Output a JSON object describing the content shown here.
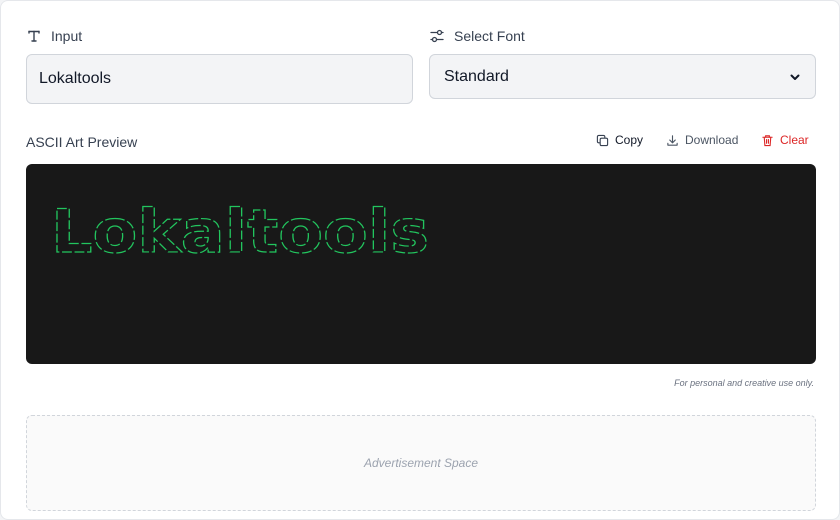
{
  "input": {
    "label": "Input",
    "value": "Lokaltools"
  },
  "font": {
    "label": "Select Font",
    "selected": "Standard"
  },
  "preview": {
    "title": "ASCII Art Preview",
    "text": "Lokaltools",
    "text_color": "#22c55e",
    "background": "#181818"
  },
  "actions": {
    "copy": "Copy",
    "download": "Download",
    "clear": "Clear",
    "clear_color": "#dc2626"
  },
  "disclaimer": "For personal and creative use only.",
  "ad_text": "Advertisement Space"
}
